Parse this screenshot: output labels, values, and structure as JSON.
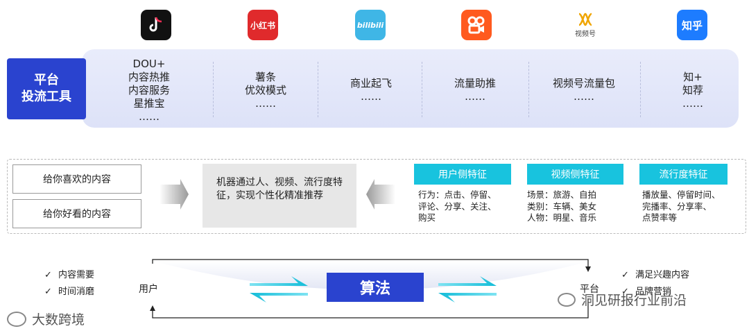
{
  "platforms": {
    "tiktok_icon": "tiktok-icon",
    "xiaohongshu_text": "小红书",
    "bilibili_text": "bilibili",
    "kuaishou_icon": "kuaishou-icon",
    "channels_text": "视频号",
    "zhihu_text": "知乎"
  },
  "tools": {
    "label_line1": "平台",
    "label_line2": "投流工具",
    "items": [
      {
        "lines": [
          "DOU+",
          "内容热推",
          "内容服务",
          "星推宝",
          "……"
        ]
      },
      {
        "lines": [
          "薯条",
          "优效模式",
          "……"
        ]
      },
      {
        "lines": [
          "商业起飞",
          "……"
        ]
      },
      {
        "lines": [
          "流量助推",
          "……"
        ]
      },
      {
        "lines": [
          "视频号流量包",
          "……"
        ]
      },
      {
        "lines": [
          "知+",
          "知荐",
          "……"
        ]
      }
    ]
  },
  "recommend": {
    "like_boxes": [
      "给你喜欢的内容",
      "给你好看的内容"
    ],
    "machine_text": "机器通过人、视频、流行度特征，实现个性化精准推荐",
    "features": [
      {
        "title": "用户侧特征",
        "lines": [
          "行为：点击、停留、",
          "评论、分享、关注、",
          "购买"
        ]
      },
      {
        "title": "视频侧特征",
        "lines": [
          "场景：旅游、自拍",
          "类别：车辆、美女",
          "人物：明星、音乐"
        ]
      },
      {
        "title": "流行度特征",
        "lines": [
          "播放量、停留时间、",
          "完播率、分享率、",
          "点赞率等"
        ]
      }
    ]
  },
  "algorithm": {
    "left_checks": [
      "内容需要",
      "时间消磨"
    ],
    "right_checks": [
      "满足兴趣内容",
      "品牌营销"
    ],
    "user_label": "用户",
    "platform_label": "平台",
    "center_label": "算法"
  },
  "watermarks": {
    "bottom_left": "大数跨境",
    "bottom_right": "洞见研报行业前沿"
  },
  "colors": {
    "primary_blue": "#2a43cf",
    "cyan": "#18c3de",
    "band": "#e3e7f9"
  }
}
